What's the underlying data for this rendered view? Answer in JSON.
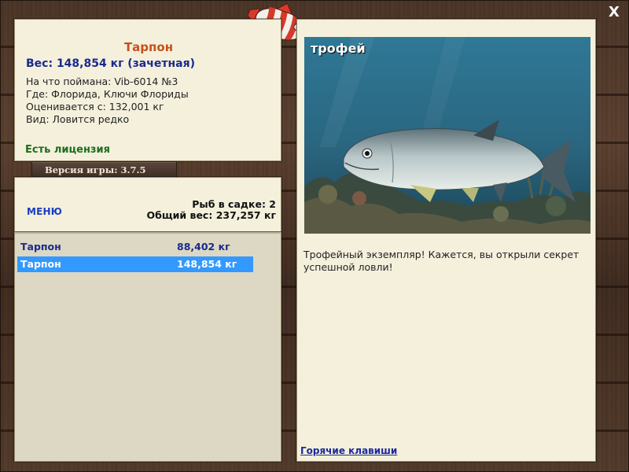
{
  "info": {
    "fish_name": "Тарпон",
    "weight_line": "Вес: 148,854 кг (зачетная)",
    "caught_on": "На что поймана: Vib-6014 №3",
    "location": "Где: Флорида, Ключи Флориды",
    "rated_from": "Оценивается с: 132,001 кг",
    "species": "Вид: Ловится редко",
    "license": "Есть лицензия"
  },
  "version": "Версия игры: 3.7.5",
  "menu": {
    "menu_label": "МЕНЮ",
    "fish_in_net": "Рыб в садке: 2",
    "total_weight": "Общий вес: 237,257 кг"
  },
  "catches": [
    {
      "name": "Тарпон",
      "weight": "88,402 кг"
    },
    {
      "name": "Тарпон",
      "weight": "148,854 кг"
    }
  ],
  "trophy": {
    "label": "трофей",
    "text": "Трофейный экземпляр! Кажется, вы открыли секрет успешной ловли!"
  },
  "hotkeys": "Горячие клавиши",
  "close": "X",
  "colors": {
    "fish_name": "#c8501a",
    "weight": "#1a2a8c",
    "license": "#1d6e1d",
    "menu": "#1a3cc0",
    "selected_row": "#3399ff",
    "panel_bg": "#f4f0dc"
  },
  "icons": {
    "emblem": "striped-fish-icon",
    "close": "close-icon"
  }
}
